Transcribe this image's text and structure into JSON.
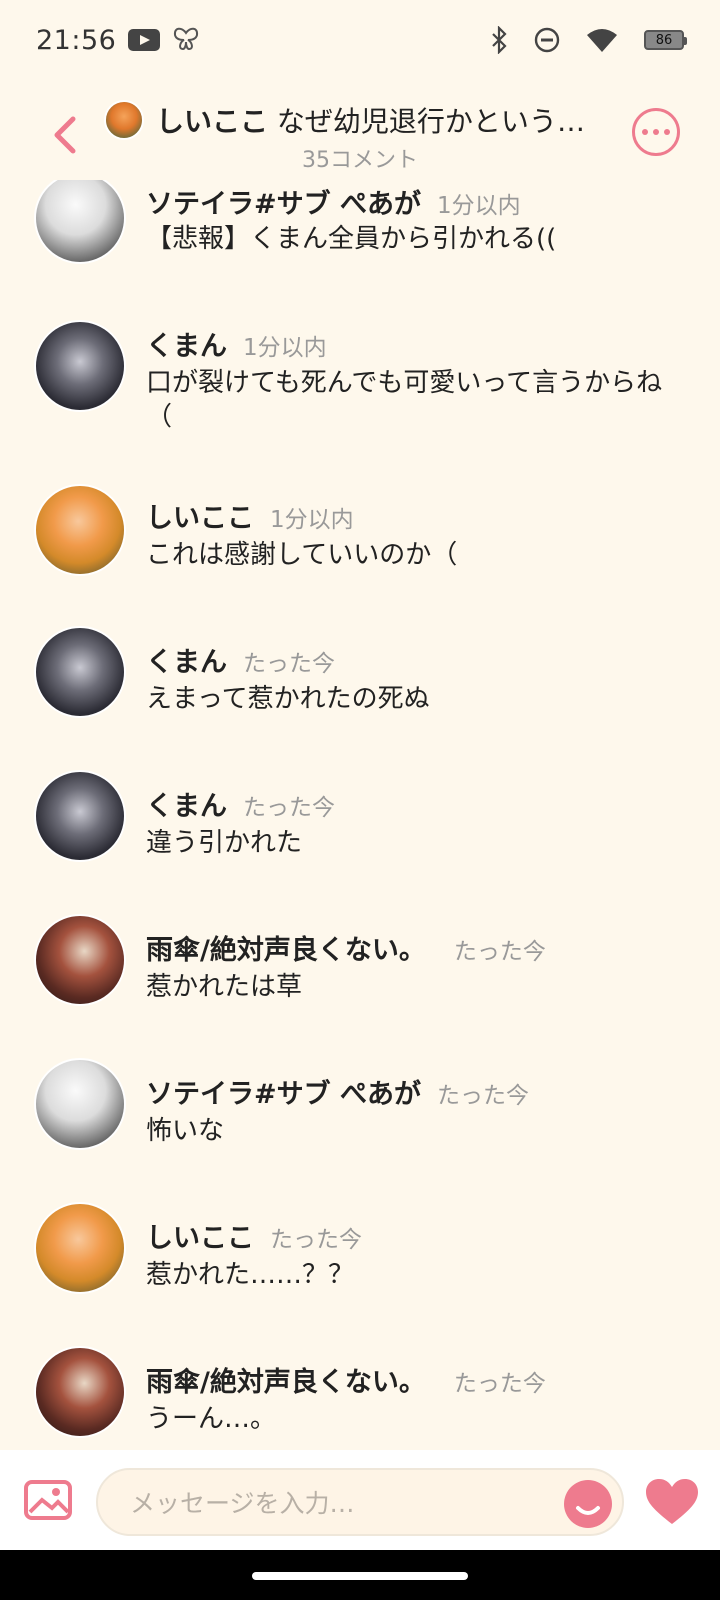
{
  "status_bar": {
    "time": "21:56",
    "battery_level": "86",
    "icons": [
      "youtube-icon",
      "butterfly-icon",
      "bluetooth-icon",
      "do-not-disturb-icon",
      "wifi-icon",
      "battery-icon"
    ]
  },
  "header": {
    "title_name": "しいここ",
    "title_text": "なぜ幼児退行かというと…",
    "comment_count": "35コメント",
    "back_icon": "chevron-left-icon",
    "more_icon": "more-icon"
  },
  "messages": [
    {
      "name": "ソテイラ#サブ ぺあが",
      "time": "1分以内",
      "text": "【悲報】くまん全員から引かれる((",
      "avatar": "soteira"
    },
    {
      "name": "くまん",
      "time": "1分以内",
      "text": "口が裂けても死んでも可愛いって言うからね（",
      "avatar": "kuman"
    },
    {
      "name": "しいここ",
      "time": "1分以内",
      "text": "これは感謝していいのか（",
      "avatar": "shiiko"
    },
    {
      "name": "くまん",
      "time": "たった今",
      "text": "えまって惹かれたの死ぬ",
      "avatar": "kuman"
    },
    {
      "name": "くまん",
      "time": "たった今",
      "text": "違う引かれた",
      "avatar": "kuman"
    },
    {
      "name": "雨傘/絶対声良くない。",
      "time": "たった今",
      "text": "惹かれたは草",
      "avatar": "amagasa"
    },
    {
      "name": "ソテイラ#サブ ぺあが",
      "time": "たった今",
      "text": "怖いな",
      "avatar": "soteira"
    },
    {
      "name": "しいここ",
      "time": "たった今",
      "text": "惹かれた……？？",
      "avatar": "shiiko"
    },
    {
      "name": "雨傘/絶対声良くない。",
      "time": "たった今",
      "text": "うーん…。",
      "avatar": "amagasa"
    }
  ],
  "composer": {
    "placeholder": "メッセージを入力…",
    "image_icon": "image-icon",
    "emoji_icon": "emoji-icon",
    "like_icon": "heart-icon"
  },
  "colors": {
    "background": "#FEF8EC",
    "accent": "#EE7B8E",
    "meta_text": "#999999"
  }
}
